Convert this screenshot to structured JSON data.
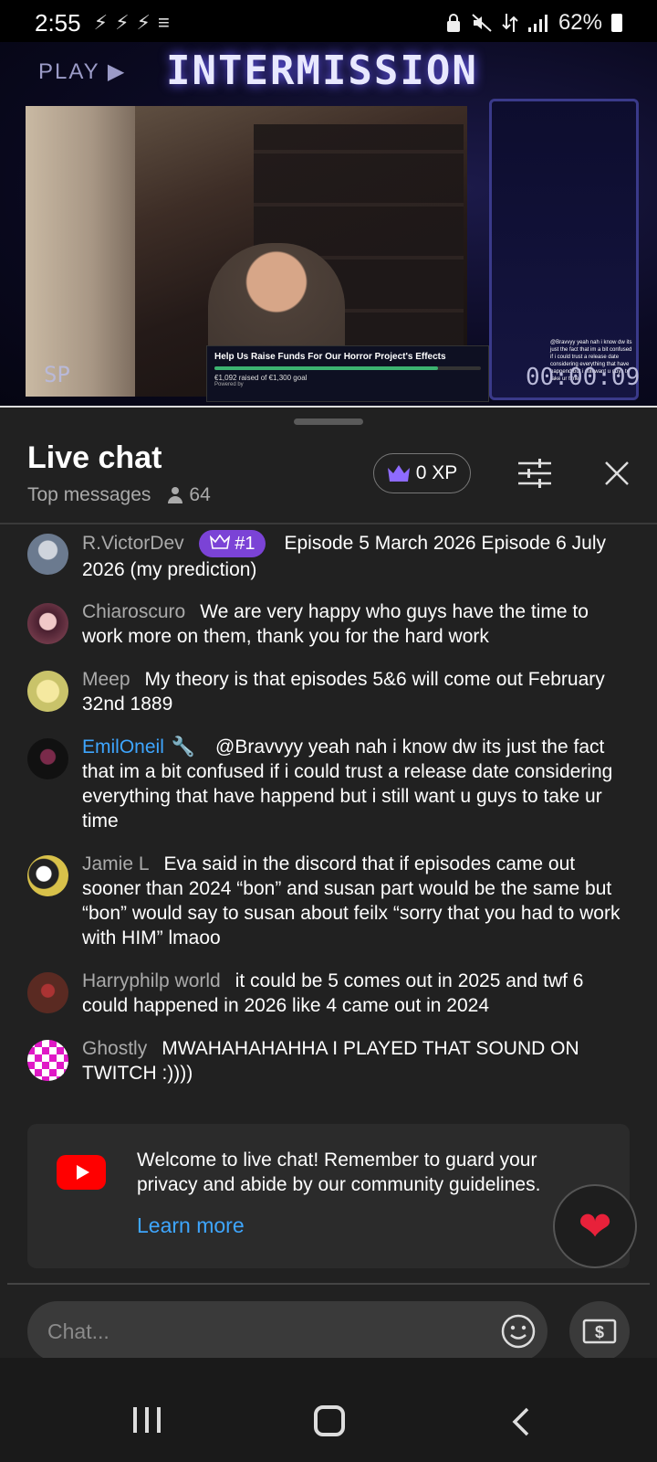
{
  "status_bar": {
    "time": "2:55",
    "left_icons": [
      "⚡",
      "⚡",
      "⚡",
      "≡"
    ],
    "battery": "62%"
  },
  "video": {
    "play_label": "PLAY ▶",
    "title": "INTERMISSION",
    "overlay_left": "SP",
    "timer": "00:00:09",
    "fundraiser": {
      "title": "Help Us Raise Funds For Our Horror Project's Effects",
      "amount": "€1,092 raised of €1,300 goal",
      "powered": "Powered by",
      "progress": 0.84
    },
    "side_chat": "@Bravvyy yeah nah i know dw its just the fact that im a bit confused if i could trust a release date considering everything that have happend but i still want u guys to take ur time"
  },
  "chat": {
    "title": "Live chat",
    "filter": "Top messages",
    "viewers": "64",
    "xp": "0 XP",
    "messages": [
      {
        "author": "R.VictorDev",
        "badge": "#1",
        "text": "Episode 5 March 2026 Episode 6 July 2026 (my prediction)",
        "avatar_color": "#6b7a8f"
      },
      {
        "author": "Chiaroscuro",
        "text": "We are very happy who guys have the time to work more on them, thank you for the hard work",
        "avatar_color": "#8a4a5a"
      },
      {
        "author": "Meep",
        "text": "My theory is that episodes 5&6 will come out February 32nd 1889",
        "avatar_color": "#c9c36a"
      },
      {
        "author": "EmilOneil",
        "text": "@Bravvyy yeah nah i know dw its just the fact that im a bit confused if i could trust a release date considering everything that have happend but i still want u guys to take ur time",
        "avatar_color": "#111111"
      },
      {
        "author": "Jamie L",
        "text": "Eva said in the discord that if episodes came out sooner than 2024 “bon” and susan part would be the same but “bon” would say to susan about feilx “sorry that you had to work with HIM” lmaoo",
        "avatar_color": "#d8c14a"
      },
      {
        "author": "Harryphilp world",
        "text": "it could be 5 comes out in 2025 and twf 6 could happened in 2026 like 4 came out in 2024",
        "avatar_color": "#5a2a22"
      },
      {
        "author": "Ghostly",
        "text": "MWAHAHAHAHHA I PLAYED THAT SOUND ON TWITCH :))))",
        "avatar_color": "#e018c6"
      }
    ],
    "welcome": {
      "text": "Welcome to live chat! Remember to guard your privacy and abide by our community guidelines.",
      "link": "Learn more"
    },
    "input_placeholder": "Chat...",
    "heart": "❤"
  },
  "colors": {
    "panel_bg": "#212121",
    "link_blue": "#3ea6ff",
    "badge_purple": "#7b43d6",
    "youtube_red": "#ff0000"
  }
}
